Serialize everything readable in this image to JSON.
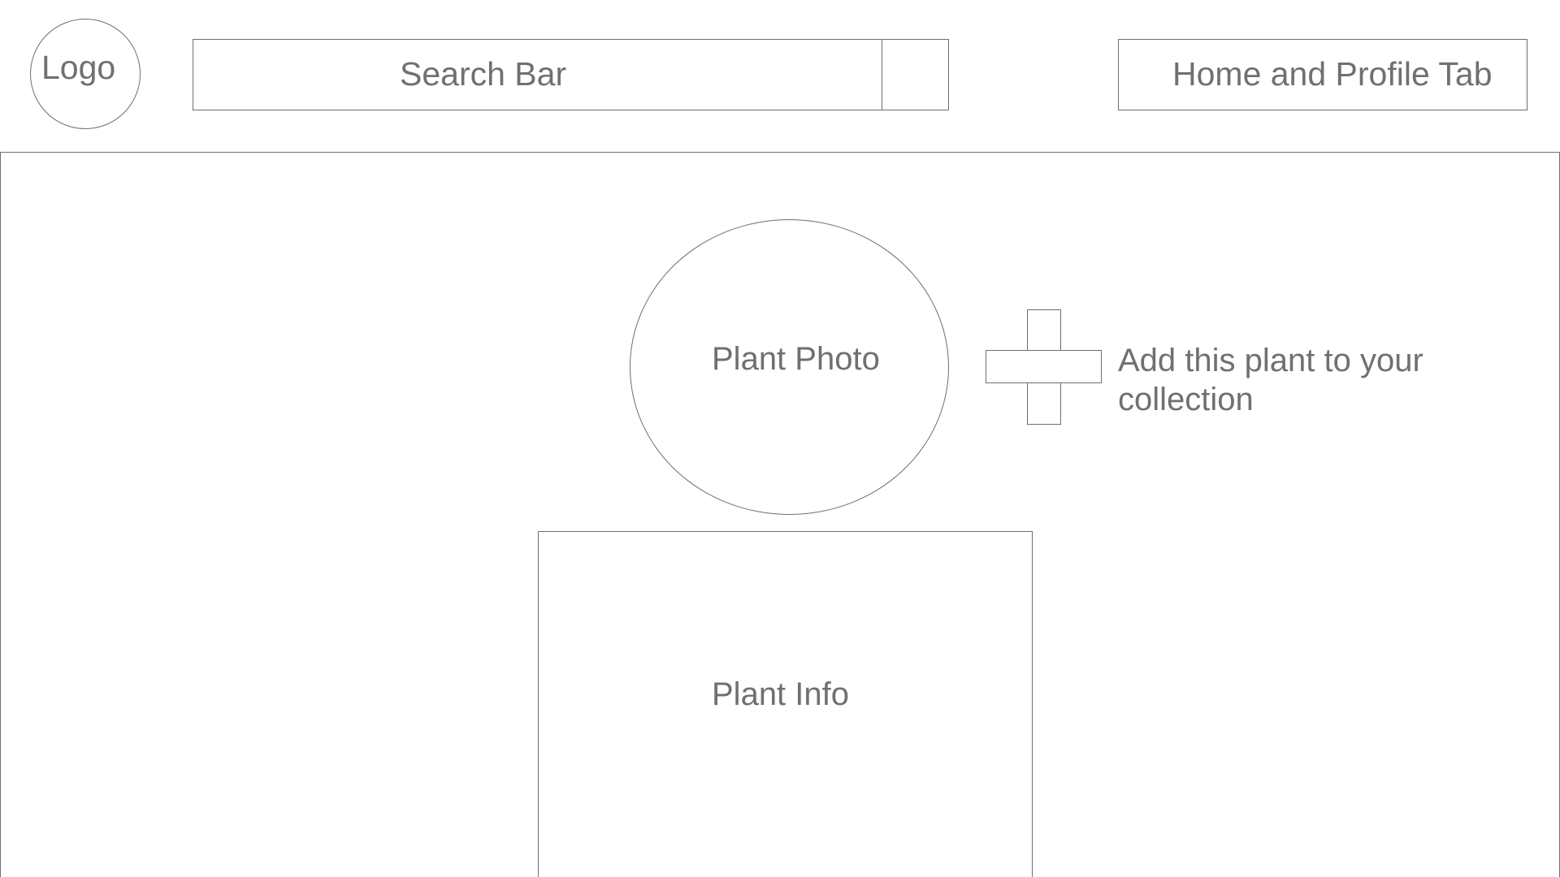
{
  "header": {
    "logo_label": "Logo",
    "search_label": "Search Bar",
    "nav_label": "Home and Profile Tab"
  },
  "main": {
    "photo_label": "Plant Photo",
    "add_label": "Add this plant to your collection",
    "info_label": "Plant Info"
  },
  "icons": {
    "add": "plus-icon"
  },
  "colors": {
    "stroke": "#6f6f6f",
    "text": "#707070",
    "background": "#ffffff"
  }
}
